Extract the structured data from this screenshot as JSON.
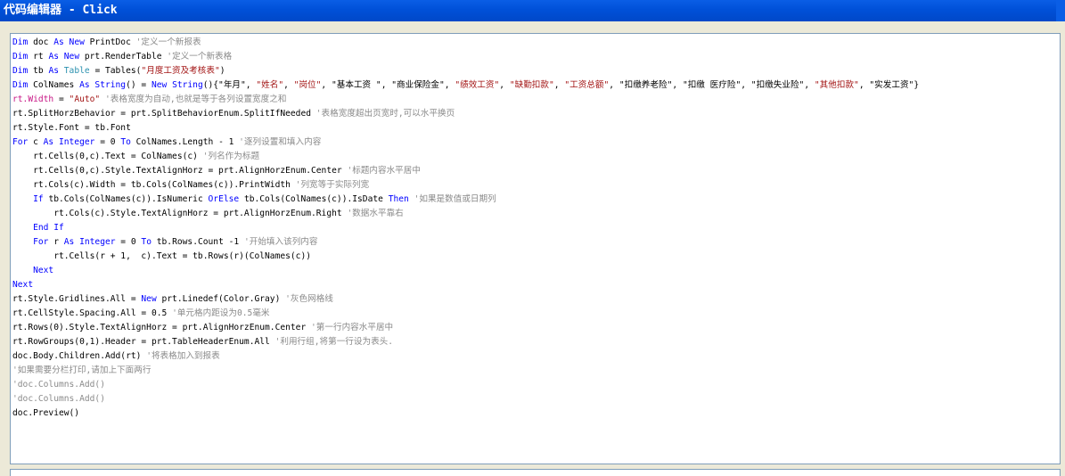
{
  "window": {
    "title": "代码编辑器 - Click"
  },
  "colors": {
    "titlebar": "#0050d8",
    "keyword": "#0000ff",
    "string": "#a31515",
    "comment": "#8a8a8a",
    "editor_bg": "#ffffff"
  },
  "code_lines": [
    [
      [
        "kw",
        "Dim"
      ],
      [
        "op",
        " doc "
      ],
      [
        "kw",
        "As New"
      ],
      [
        "op",
        " PrintDoc "
      ],
      [
        "cm",
        "'定义一个新报表"
      ]
    ],
    [
      [
        "kw",
        "Dim"
      ],
      [
        "op",
        " rt "
      ],
      [
        "kw",
        "As New"
      ],
      [
        "op",
        " prt.RenderTable "
      ],
      [
        "cm",
        "'定义一个新表格"
      ]
    ],
    [
      [
        "kw",
        "Dim"
      ],
      [
        "op",
        " tb "
      ],
      [
        "kw",
        "As"
      ],
      [
        "op",
        " "
      ],
      [
        "ty",
        "Table"
      ],
      [
        "op",
        " = Tables("
      ],
      [
        "str",
        "\"月度工资及考核表\""
      ],
      [
        "op",
        ")"
      ]
    ],
    [
      [
        "kw",
        "Dim"
      ],
      [
        "op",
        " ColNames "
      ],
      [
        "kw",
        "As String"
      ],
      [
        "op",
        "() = "
      ],
      [
        "kw",
        "New String"
      ],
      [
        "op",
        "(){\"年月\", "
      ],
      [
        "str",
        "\"姓名\""
      ],
      [
        "op",
        ", "
      ],
      [
        "str",
        "\"岗位\""
      ],
      [
        "op",
        ", "
      ],
      [
        "op",
        "\"基本工资 \""
      ],
      [
        "op",
        ", "
      ],
      [
        "op",
        "\"商业保险金\""
      ],
      [
        "op",
        ", "
      ],
      [
        "str",
        "\"绩效工资\""
      ],
      [
        "op",
        ", "
      ],
      [
        "str",
        "\"缺勤扣款\""
      ],
      [
        "op",
        ", "
      ],
      [
        "str",
        "\"工资总额\""
      ],
      [
        "op",
        ", "
      ],
      [
        "op",
        "\"扣缴养老险\""
      ],
      [
        "op",
        ", "
      ],
      [
        "op",
        "\"扣缴 医疗险\""
      ],
      [
        "op",
        ", "
      ],
      [
        "op",
        "\"扣缴失业险\""
      ],
      [
        "op",
        ", "
      ],
      [
        "str",
        "\"其他扣款\""
      ],
      [
        "op",
        ", "
      ],
      [
        "op",
        "\"实发工资\"}"
      ]
    ],
    [
      [
        "type-fn",
        "rt.Width"
      ],
      [
        "op",
        " = "
      ],
      [
        "str",
        "\"Auto\""
      ],
      [
        "op",
        " "
      ],
      [
        "cm",
        "'表格宽度为自动,也就是等于各列设置宽度之和"
      ]
    ],
    [
      [
        "op",
        "rt.SplitHorzBehavior = prt.SplitBehaviorEnum.SplitIfNeeded "
      ],
      [
        "cm",
        "'表格宽度超出页宽时,可以水平换页"
      ]
    ],
    [
      [
        "op",
        "rt.Style.Font = tb.Font"
      ]
    ],
    [
      [
        "kw",
        "For"
      ],
      [
        "op",
        " c "
      ],
      [
        "kw",
        "As Integer"
      ],
      [
        "op",
        " = 0 "
      ],
      [
        "kw",
        "To"
      ],
      [
        "op",
        " ColNames.Length - 1 "
      ],
      [
        "cm",
        "'逐列设置和填入内容"
      ]
    ],
    [
      [
        "op",
        "    rt.Cells(0,c).Text = ColNames(c) "
      ],
      [
        "cm",
        "'列名作为标题"
      ]
    ],
    [
      [
        "op",
        "    rt.Cells(0,c).Style.TextAlignHorz = prt.AlignHorzEnum.Center "
      ],
      [
        "cm",
        "'标题内容水平居中"
      ]
    ],
    [
      [
        "op",
        "    rt.Cols(c).Width = tb.Cols(ColNames(c)).PrintWidth "
      ],
      [
        "cm",
        "'列宽等于实际列宽"
      ]
    ],
    [
      [
        "op",
        "    "
      ],
      [
        "kw",
        "If"
      ],
      [
        "op",
        " tb.Cols(ColNames(c)).IsNumeric "
      ],
      [
        "kw",
        "OrElse"
      ],
      [
        "op",
        " tb.Cols(ColNames(c)).IsDate "
      ],
      [
        "kw",
        "Then"
      ],
      [
        "op",
        " "
      ],
      [
        "cm",
        "'如果是数值或日期列"
      ]
    ],
    [
      [
        "op",
        "        rt.Cols(c).Style.TextAlignHorz = prt.AlignHorzEnum.Right "
      ],
      [
        "cm",
        "'数据水平靠右"
      ]
    ],
    [
      [
        "op",
        "    "
      ],
      [
        "kw",
        "End If"
      ]
    ],
    [
      [
        "op",
        "    "
      ],
      [
        "kw",
        "For"
      ],
      [
        "op",
        " r "
      ],
      [
        "kw",
        "As Integer"
      ],
      [
        "op",
        " = 0 "
      ],
      [
        "kw",
        "To"
      ],
      [
        "op",
        " tb.Rows.Count -1 "
      ],
      [
        "cm",
        "'开始填入该列内容"
      ]
    ],
    [
      [
        "op",
        "        rt.Cells(r + 1,  c).Text = tb.Rows(r)(ColNames(c))"
      ]
    ],
    [
      [
        "op",
        "    "
      ],
      [
        "kw",
        "Next"
      ]
    ],
    [
      [
        "kw",
        "Next"
      ]
    ],
    [
      [
        "op",
        "rt.Style.Gridlines.All = "
      ],
      [
        "kw",
        "New"
      ],
      [
        "op",
        " prt.Linedef(Color.Gray) "
      ],
      [
        "cm",
        "'灰色网格线"
      ]
    ],
    [
      [
        "op",
        "rt.CellStyle.Spacing.All = 0.5 "
      ],
      [
        "cm",
        "'单元格内距设为0.5毫米"
      ]
    ],
    [
      [
        "op",
        "rt.Rows(0).Style.TextAlignHorz = prt.AlignHorzEnum.Center "
      ],
      [
        "cm",
        "'第一行内容水平居中"
      ]
    ],
    [
      [
        "op",
        "rt.RowGroups(0,1).Header = prt.TableHeaderEnum.All "
      ],
      [
        "cm",
        "'利用行组,将第一行设为表头."
      ]
    ],
    [
      [
        "op",
        "doc.Body.Children.Add(rt) "
      ],
      [
        "cm",
        "'将表格加入到报表"
      ]
    ],
    [
      [
        "cm",
        "'如果需要分栏打印,请加上下面两行"
      ]
    ],
    [
      [
        "cm",
        "'doc.Columns.Add()"
      ]
    ],
    [
      [
        "cm",
        "'doc.Columns.Add()"
      ]
    ],
    [
      [
        "op",
        "doc.Preview()"
      ]
    ]
  ]
}
